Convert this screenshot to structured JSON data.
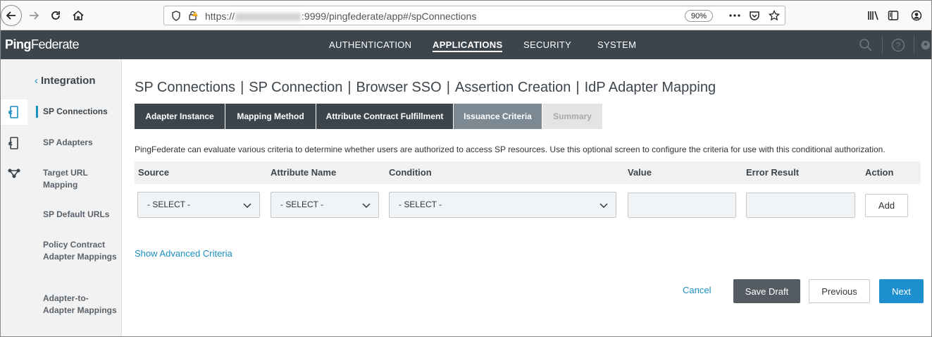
{
  "browser": {
    "url_prefix": "https://",
    "url_suffix": ":9999/pingfederate/app#/spConnections",
    "zoom": "90%"
  },
  "app": {
    "logo_bold": "Ping",
    "logo_rest": "Federate",
    "nav": [
      "AUTHENTICATION",
      "APPLICATIONS",
      "SECURITY",
      "SYSTEM"
    ],
    "active_nav": "APPLICATIONS"
  },
  "sidebar": {
    "title": "Integration",
    "items": [
      {
        "label": "SP Connections"
      },
      {
        "label": "SP Adapters"
      },
      {
        "label": "Target URL Mapping"
      },
      {
        "label": "SP Default URLs"
      },
      {
        "label": "Policy Contract Adapter Mappings"
      },
      {
        "label": "Adapter-to-Adapter Mappings"
      }
    ]
  },
  "breadcrumb": [
    "SP Connections",
    "SP Connection",
    "Browser SSO",
    "Assertion Creation",
    "IdP Adapter Mapping"
  ],
  "steps": [
    {
      "label": "Adapter Instance",
      "state": "done"
    },
    {
      "label": "Mapping Method",
      "state": "done"
    },
    {
      "label": "Attribute Contract Fulfillment",
      "state": "done"
    },
    {
      "label": "Issuance Criteria",
      "state": "current"
    },
    {
      "label": "Summary",
      "state": "future"
    }
  ],
  "description": "PingFederate can evaluate various criteria to determine whether users are authorized to access SP resources. Use this optional screen to configure the criteria for use with this conditional authorization.",
  "table": {
    "headers": [
      "Source",
      "Attribute Name",
      "Condition",
      "Value",
      "Error Result",
      "Action"
    ],
    "source_value": "- SELECT -",
    "attribute_value": "- SELECT -",
    "condition_value": "- SELECT -",
    "add_label": "Add"
  },
  "advanced_link": "Show Advanced Criteria",
  "footer": {
    "cancel": "Cancel",
    "save_draft": "Save Draft",
    "previous": "Previous",
    "next": "Next"
  },
  "colors": {
    "header": "#3d454c",
    "accent": "#1a8fc1",
    "next_button": "#1d8fcf"
  }
}
